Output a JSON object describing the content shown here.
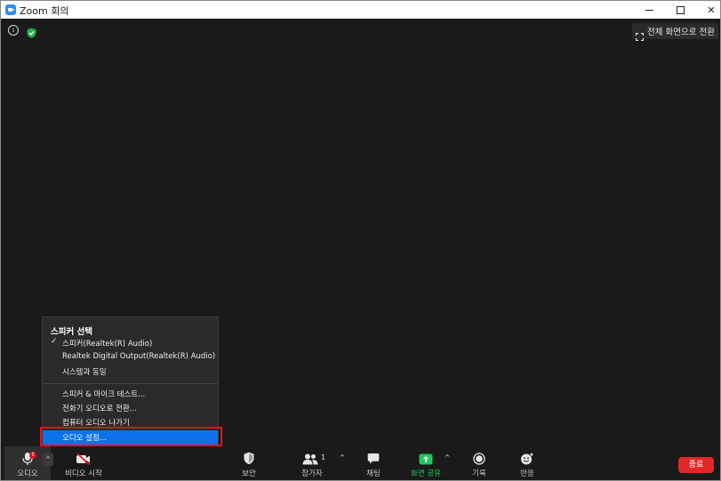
{
  "window": {
    "title": "Zoom 회의",
    "minimize_icon": "minimize-icon",
    "maximize_icon": "maximize-icon",
    "close_label": "✕"
  },
  "top_bar": {
    "info_label": "i",
    "fullscreen_label": "전체 화면으로 전환"
  },
  "audio_menu": {
    "header": "스피커 선택",
    "check_mark": "✓",
    "speakers": [
      "스피커(Realtek(R) Audio)",
      "Realtek Digital Output(Realtek(R) Audio)",
      "시스템과 동일"
    ],
    "actions": [
      "스피커 & 마이크 테스트...",
      "전화기 오디오로 전환...",
      "컴퓨터 오디오 나가기",
      "오디오 설정..."
    ],
    "selected_speaker_index": 0,
    "highlighted_action_index": 3
  },
  "toolbar": {
    "audio_label": "오디오",
    "audio_alert": "!",
    "caret": "^",
    "video_label": "비디오 시작",
    "security_label": "보안",
    "participants_label": "참가자",
    "participants_count": "1",
    "chat_label": "채팅",
    "share_label": "화면 공유",
    "record_label": "기록",
    "reactions_label": "반응",
    "end_label": "종료"
  },
  "colors": {
    "share_green": "#22c55e",
    "end_red": "#e02828",
    "highlight_blue": "#0e71eb",
    "annotation_red": "#e8101a"
  }
}
